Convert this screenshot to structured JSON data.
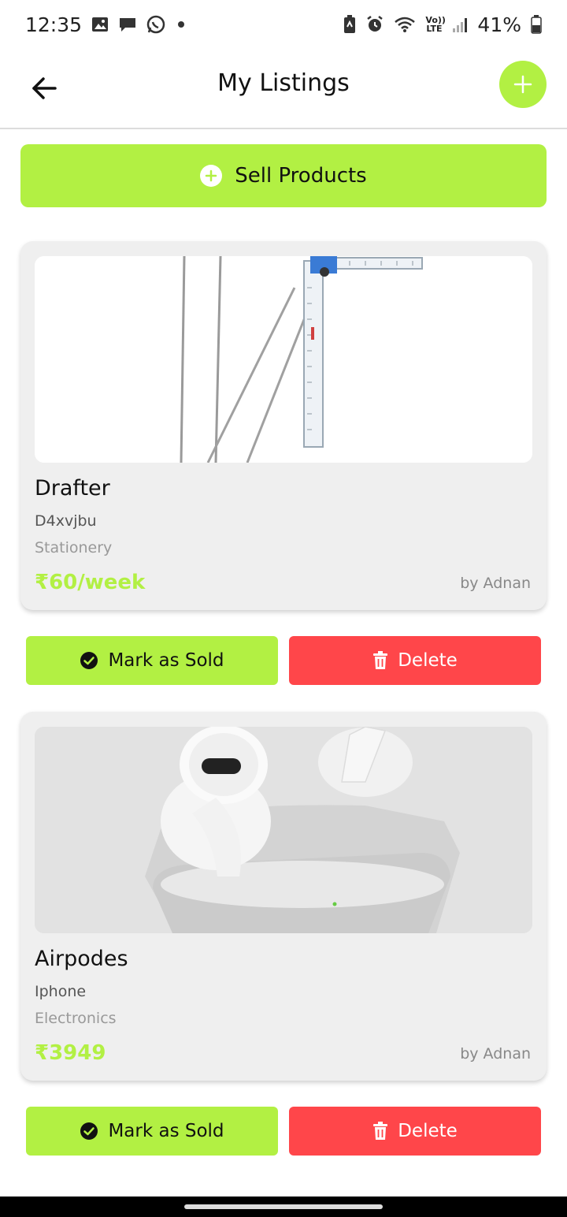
{
  "status_bar": {
    "time": "12:35",
    "battery": "41%",
    "network": "Vo)) LTE",
    "icons": [
      "gallery-icon",
      "chat-icon",
      "whatsapp-icon",
      "battery-saver-icon",
      "alarm-icon",
      "wifi-icon",
      "signal-icon",
      "battery-icon"
    ]
  },
  "header": {
    "title": "My Listings",
    "back_icon": "arrow-left-icon",
    "add_icon": "plus-icon"
  },
  "sell_button": {
    "label": "Sell Products"
  },
  "listings": [
    {
      "title": "Drafter",
      "description": "D4xvjbu",
      "category": "Stationery",
      "price": "₹60/week",
      "owner": "by Adnan",
      "mark_label": "Mark as Sold",
      "delete_label": "Delete"
    },
    {
      "title": "Airpodes",
      "description": "Iphone",
      "category": "Electronics",
      "price": "₹3949",
      "owner": "by Adnan",
      "mark_label": "Mark as Sold",
      "delete_label": "Delete"
    }
  ],
  "colors": {
    "accent": "#b2f043",
    "danger": "#ff464a",
    "card_bg": "#efefef"
  }
}
